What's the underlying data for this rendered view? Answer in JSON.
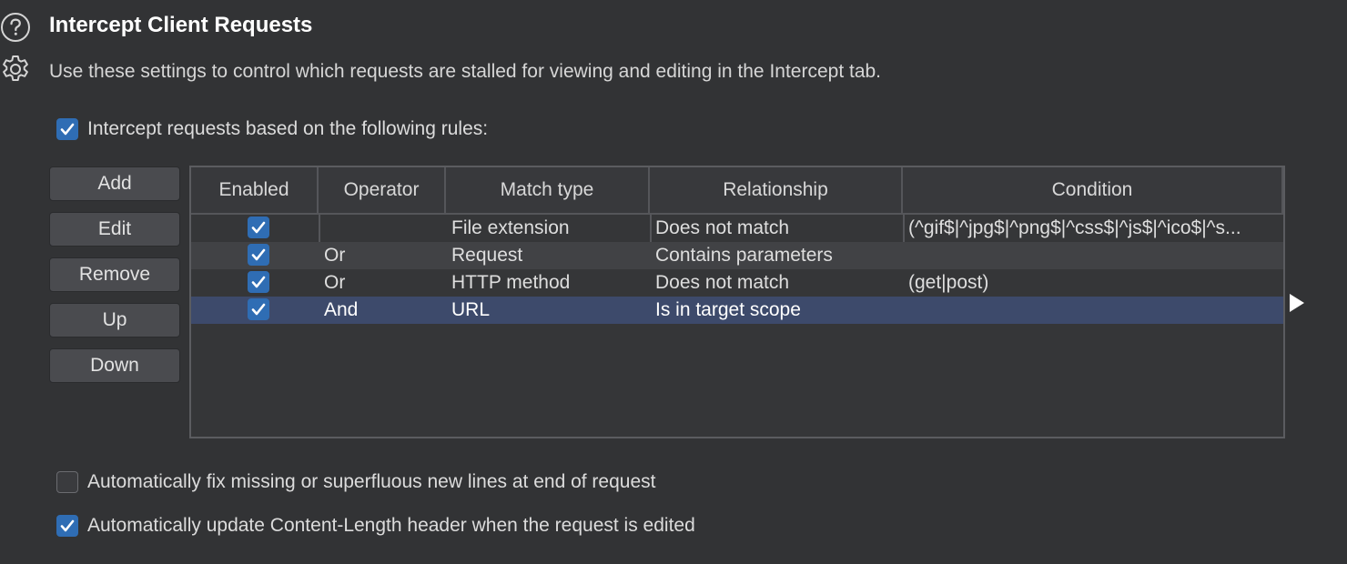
{
  "header": {
    "title": "Intercept Client Requests",
    "description": "Use these settings to control which requests are stalled for viewing and editing in the Intercept tab."
  },
  "intercept_rules_checkbox": {
    "label": "Intercept requests based on the following rules:",
    "checked": true
  },
  "buttons": {
    "add": "Add",
    "edit": "Edit",
    "remove": "Remove",
    "up": "Up",
    "down": "Down"
  },
  "table": {
    "columns": [
      "Enabled",
      "Operator",
      "Match type",
      "Relationship",
      "Condition"
    ],
    "rows": [
      {
        "enabled": true,
        "operator": "",
        "match_type": "File extension",
        "relationship": "Does not match",
        "condition": "(^gif$|^jpg$|^png$|^css$|^js$|^ico$|^s..."
      },
      {
        "enabled": true,
        "operator": "Or",
        "match_type": "Request",
        "relationship": "Contains parameters",
        "condition": ""
      },
      {
        "enabled": true,
        "operator": "Or",
        "match_type": "HTTP method",
        "relationship": "Does not match",
        "condition": "(get|post)"
      },
      {
        "enabled": true,
        "operator": "And",
        "match_type": "URL",
        "relationship": "Is in target scope",
        "condition": ""
      }
    ],
    "selected_row": 3
  },
  "options": {
    "fix_newlines": {
      "label": "Automatically fix missing or superfluous new lines at end of request",
      "checked": false
    },
    "update_content_length": {
      "label": "Automatically update Content-Length header when the request is edited",
      "checked": true
    }
  },
  "icons": {
    "help": "help-circle-icon",
    "settings": "gear-icon",
    "expand": "play-arrow-icon"
  },
  "colors": {
    "background": "#323335",
    "accent": "#2f6db4",
    "selected_row": "#3d4a6b"
  }
}
